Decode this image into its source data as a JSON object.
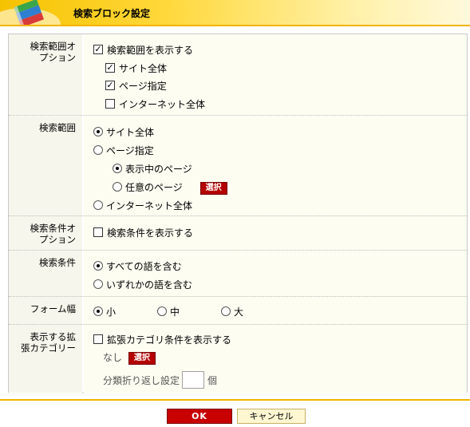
{
  "header": {
    "title": "検索ブロック設定"
  },
  "rows": {
    "scope_option": {
      "label": "検索範囲オ\nプション",
      "show_scope": {
        "label": "検索範囲を表示する",
        "checked": true
      },
      "site_all": {
        "label": "サイト全体",
        "checked": true
      },
      "page_spec": {
        "label": "ページ指定",
        "checked": true
      },
      "internet_all": {
        "label": "インターネット全体",
        "checked": false
      }
    },
    "scope": {
      "label": "検索範囲",
      "site_all": {
        "label": "サイト全体",
        "selected": true
      },
      "page_spec": {
        "label": "ページ指定",
        "selected": false
      },
      "current_page": {
        "label": "表示中のページ",
        "selected": true
      },
      "any_page": {
        "label": "任意のページ",
        "selected": false
      },
      "select_button": "選択",
      "internet_all": {
        "label": "インターネット全体",
        "selected": false
      }
    },
    "condition_option": {
      "label": "検索条件オ\nプション",
      "show_condition": {
        "label": "検索条件を表示する",
        "checked": false
      }
    },
    "condition": {
      "label": "検索条件",
      "all_words": {
        "label": "すべての語を含む",
        "selected": true
      },
      "any_word": {
        "label": "いずれかの語を含む",
        "selected": false
      }
    },
    "form_width": {
      "label": "フォーム幅",
      "small": {
        "label": "小",
        "selected": true
      },
      "medium": {
        "label": "中",
        "selected": false
      },
      "large": {
        "label": "大",
        "selected": false
      }
    },
    "ext_category": {
      "label": "表示する拡\n張カテゴリー",
      "show_ext": {
        "label": "拡張カテゴリ条件を表示する",
        "checked": false
      },
      "none_text": "なし",
      "select_button": "選択",
      "wrap_label": "分類折り返し設定",
      "wrap_value": "",
      "wrap_unit": "個"
    }
  },
  "footer": {
    "ok_label": "OK",
    "cancel_label": "キャンセル"
  },
  "colors": {
    "accent": "#f6c200",
    "ok_red": "#c80000",
    "select_red": "#b40000"
  }
}
